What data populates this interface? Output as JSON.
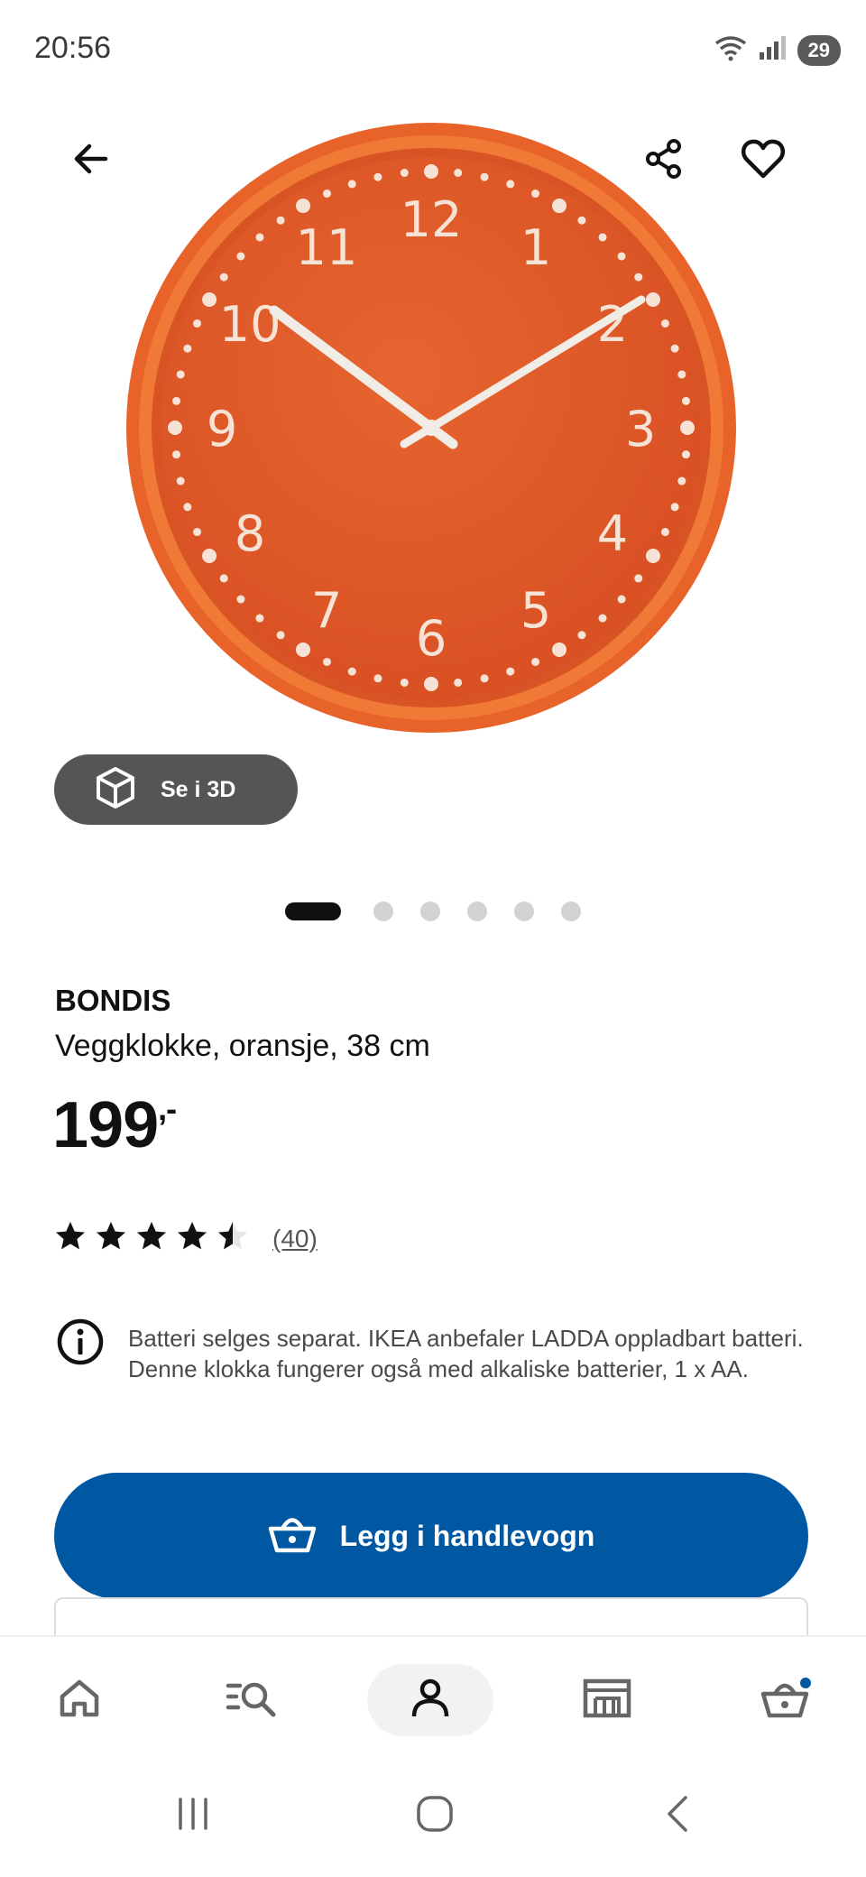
{
  "status_bar": {
    "time": "20:56",
    "battery": "29",
    "icons": [
      "wifi-icon",
      "signal-icon"
    ]
  },
  "header": {
    "icons": [
      "back-arrow-icon",
      "share-icon",
      "heart-icon"
    ]
  },
  "product_image": {
    "clock_numbers": [
      "12",
      "1",
      "2",
      "3",
      "4",
      "5",
      "6",
      "7",
      "8",
      "9",
      "10",
      "11"
    ]
  },
  "view_3d": {
    "label": "Se i 3D",
    "icon": "cube-icon"
  },
  "carousel": {
    "total": 6,
    "active": 1
  },
  "product": {
    "name": "BONDIS",
    "description": "Veggklokke, oransje, 38 cm",
    "price": "199",
    "price_suffix": ",-"
  },
  "rating": {
    "stars": 4.5,
    "max": 5,
    "count": "(40)"
  },
  "info": {
    "icon": "info-icon",
    "text": "Batteri selges separat. IKEA anbefaler LADDA oppladbart batteri. Denne klokka fungerer også med alkaliske batterier, 1 x AA."
  },
  "cart_button": {
    "label": "Legg i handlevogn",
    "icon": "basket-icon"
  },
  "bottom_nav": {
    "items": [
      "home-icon",
      "search-list-icon",
      "profile-icon",
      "store-icon",
      "cart-icon"
    ],
    "active": "profile-icon"
  },
  "colors": {
    "primary_blue": "#0058a3",
    "clock_orange": "#e0592a",
    "dark_pill": "#555555",
    "notification_dot": "#0058a3"
  }
}
